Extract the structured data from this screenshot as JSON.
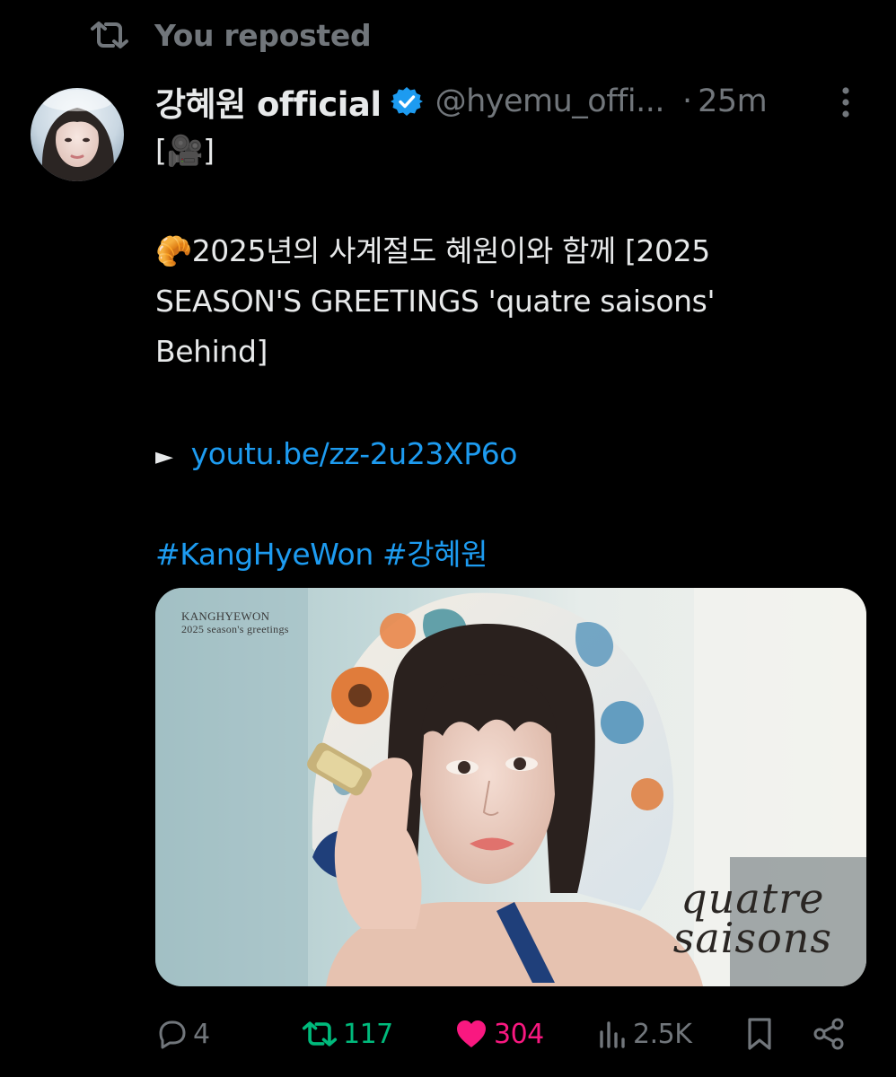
{
  "social_context": {
    "label": "You reposted",
    "icon": "repost-icon"
  },
  "post": {
    "author": {
      "display_name": "강혜원 official",
      "handle": "@hyemu_offi...",
      "verified": true,
      "avatar_icon": "avatar"
    },
    "separator": "·",
    "time": "25m",
    "more_icon": "more-vertical-icon",
    "text": {
      "line1": "[🎥]",
      "line2": "🥐2025년의 사계절도 혜원이와 함께 [2025",
      "line3": "SEASON'S GREETINGS 'quatre saisons'",
      "line4": "Behind]",
      "link_prefix": "►",
      "link": "youtu.be/zz-2u23XP6o",
      "hashtag1": "#KangHyeWon",
      "hashtag2": "#강혜원"
    },
    "media": {
      "top_caption": "KANGHYEWON",
      "top_subcaption": "2025 season's greetings",
      "title_line1": "quatre",
      "title_line2": "saisons"
    },
    "actions": {
      "reply_count": "4",
      "repost_count": "117",
      "like_count": "304",
      "views_count": "2.5K"
    }
  },
  "colors": {
    "background": "#000000",
    "text_primary": "#e7e9ea",
    "text_secondary": "#71767b",
    "link": "#1d9bf0",
    "repost_active": "#00ba7c",
    "like_active": "#f91880"
  }
}
